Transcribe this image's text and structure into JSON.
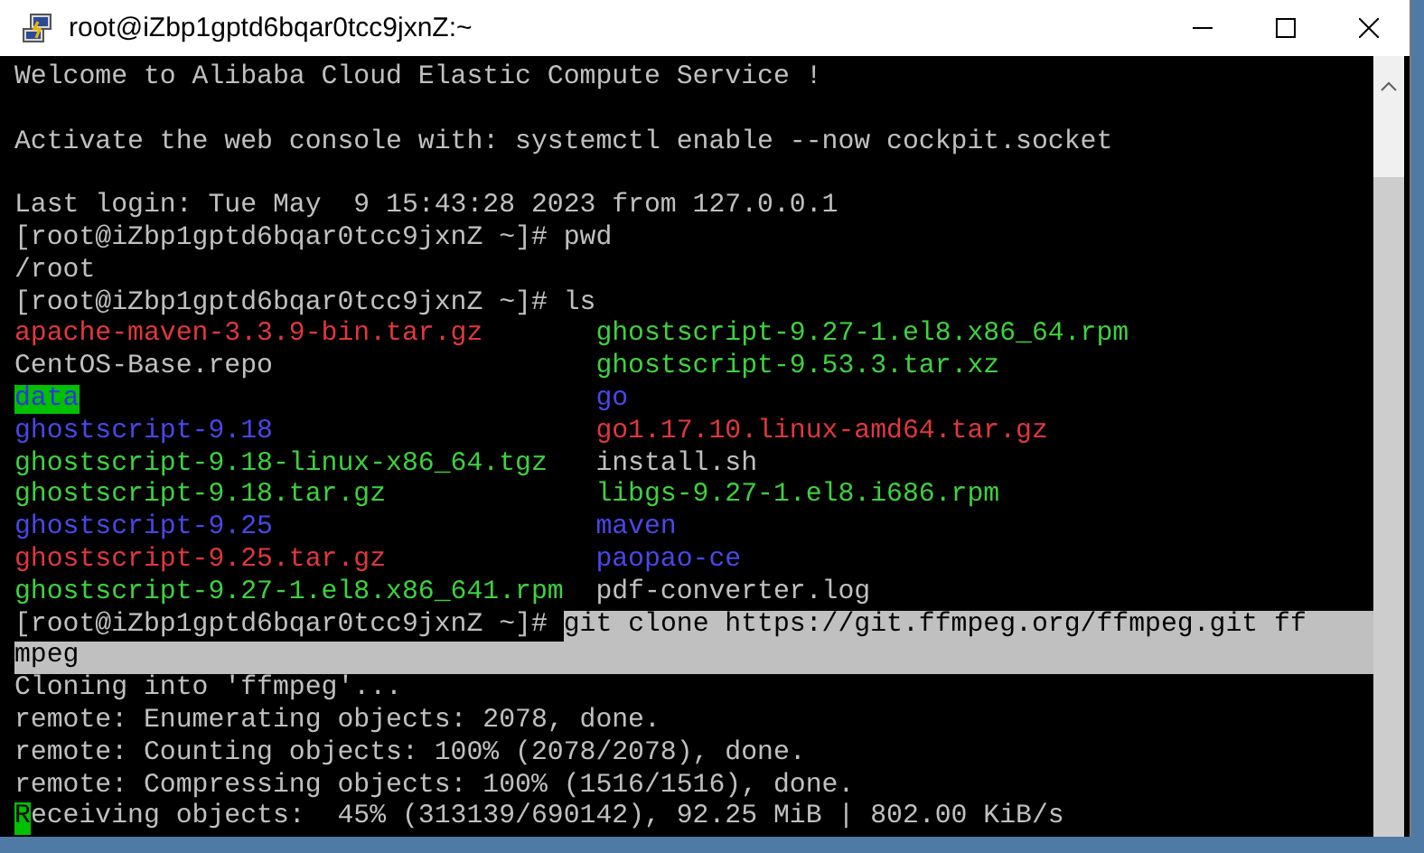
{
  "window": {
    "title": "root@iZbp1gptd6bqar0tcc9jxnZ:~"
  },
  "terminal": {
    "lines": [
      {
        "kind": "text",
        "segments": [
          {
            "kind": "output",
            "text": "Welcome to Alibaba Cloud Elastic Compute Service !"
          }
        ]
      },
      {
        "kind": "blank"
      },
      {
        "kind": "text",
        "segments": [
          {
            "kind": "output",
            "text": "Activate the web console with: systemctl enable --now cockpit.socket"
          }
        ]
      },
      {
        "kind": "blank"
      },
      {
        "kind": "text",
        "segments": [
          {
            "kind": "output",
            "text": "Last login: Tue May  9 15:43:28 2023 from 127.0.0.1"
          }
        ]
      },
      {
        "kind": "text",
        "segments": [
          {
            "kind": "prompt",
            "text": "[root@iZbp1gptd6bqar0tcc9jxnZ ~]# pwd"
          }
        ]
      },
      {
        "kind": "text",
        "segments": [
          {
            "kind": "output",
            "text": "/root"
          }
        ]
      },
      {
        "kind": "text",
        "segments": [
          {
            "kind": "prompt",
            "text": "[root@iZbp1gptd6bqar0tcc9jxnZ ~]# ls"
          }
        ]
      },
      {
        "kind": "listing",
        "entries": [
          {
            "kind": "archive",
            "text": "apache-maven-3.3.9-bin.tar.gz"
          },
          {
            "kind": "executable",
            "text": "ghostscript-9.27-1.el8.x86_64.rpm"
          }
        ]
      },
      {
        "kind": "listing",
        "entries": [
          {
            "kind": "file",
            "text": "CentOS-Base.repo"
          },
          {
            "kind": "executable",
            "text": "ghostscript-9.53.3.tar.xz"
          }
        ]
      },
      {
        "kind": "listing",
        "entries": [
          {
            "kind": "highlighted-directory",
            "text": "data"
          },
          {
            "kind": "directory",
            "text": "go"
          }
        ]
      },
      {
        "kind": "listing",
        "entries": [
          {
            "kind": "directory",
            "text": "ghostscript-9.18"
          },
          {
            "kind": "archive",
            "text": "go1.17.10.linux-amd64.tar.gz"
          }
        ]
      },
      {
        "kind": "listing",
        "entries": [
          {
            "kind": "executable",
            "text": "ghostscript-9.18-linux-x86_64.tgz"
          },
          {
            "kind": "file",
            "text": "install.sh"
          }
        ]
      },
      {
        "kind": "listing",
        "entries": [
          {
            "kind": "executable",
            "text": "ghostscript-9.18.tar.gz"
          },
          {
            "kind": "executable",
            "text": "libgs-9.27-1.el8.i686.rpm"
          }
        ]
      },
      {
        "kind": "listing",
        "entries": [
          {
            "kind": "directory",
            "text": "ghostscript-9.25"
          },
          {
            "kind": "directory",
            "text": "maven"
          }
        ]
      },
      {
        "kind": "listing",
        "entries": [
          {
            "kind": "archive",
            "text": "ghostscript-9.25.tar.gz"
          },
          {
            "kind": "directory",
            "text": "paopao-ce"
          }
        ]
      },
      {
        "kind": "listing",
        "entries": [
          {
            "kind": "executable",
            "text": "ghostscript-9.27-1.el8.x86_641.rpm"
          },
          {
            "kind": "file",
            "text": "pdf-converter.log"
          }
        ]
      },
      {
        "kind": "text",
        "segments": [
          {
            "kind": "prompt",
            "text": "[root@iZbp1gptd6bqar0tcc9jxnZ ~]# "
          },
          {
            "kind": "selection",
            "text": "git clone https://git.ffmpeg.org/ffmpeg.git ff"
          }
        ]
      },
      {
        "kind": "text",
        "segments": [
          {
            "kind": "selection",
            "text": "mpeg"
          }
        ]
      },
      {
        "kind": "text",
        "segments": [
          {
            "kind": "output",
            "text": "Cloning into 'ffmpeg'..."
          }
        ]
      },
      {
        "kind": "text",
        "segments": [
          {
            "kind": "output",
            "text": "remote: Enumerating objects: 2078, done."
          }
        ]
      },
      {
        "kind": "text",
        "segments": [
          {
            "kind": "output",
            "text": "remote: Counting objects: 100% (2078/2078), done."
          }
        ]
      },
      {
        "kind": "text",
        "segments": [
          {
            "kind": "output",
            "text": "remote: Compressing objects: 100% (1516/1516), done."
          }
        ]
      },
      {
        "kind": "text",
        "segments": [
          {
            "kind": "cursor",
            "text": "R"
          },
          {
            "kind": "output",
            "text": "eceiving objects:  45% (313139/690142), 92.25 MiB | 802.00 KiB/s"
          }
        ]
      }
    ]
  }
}
